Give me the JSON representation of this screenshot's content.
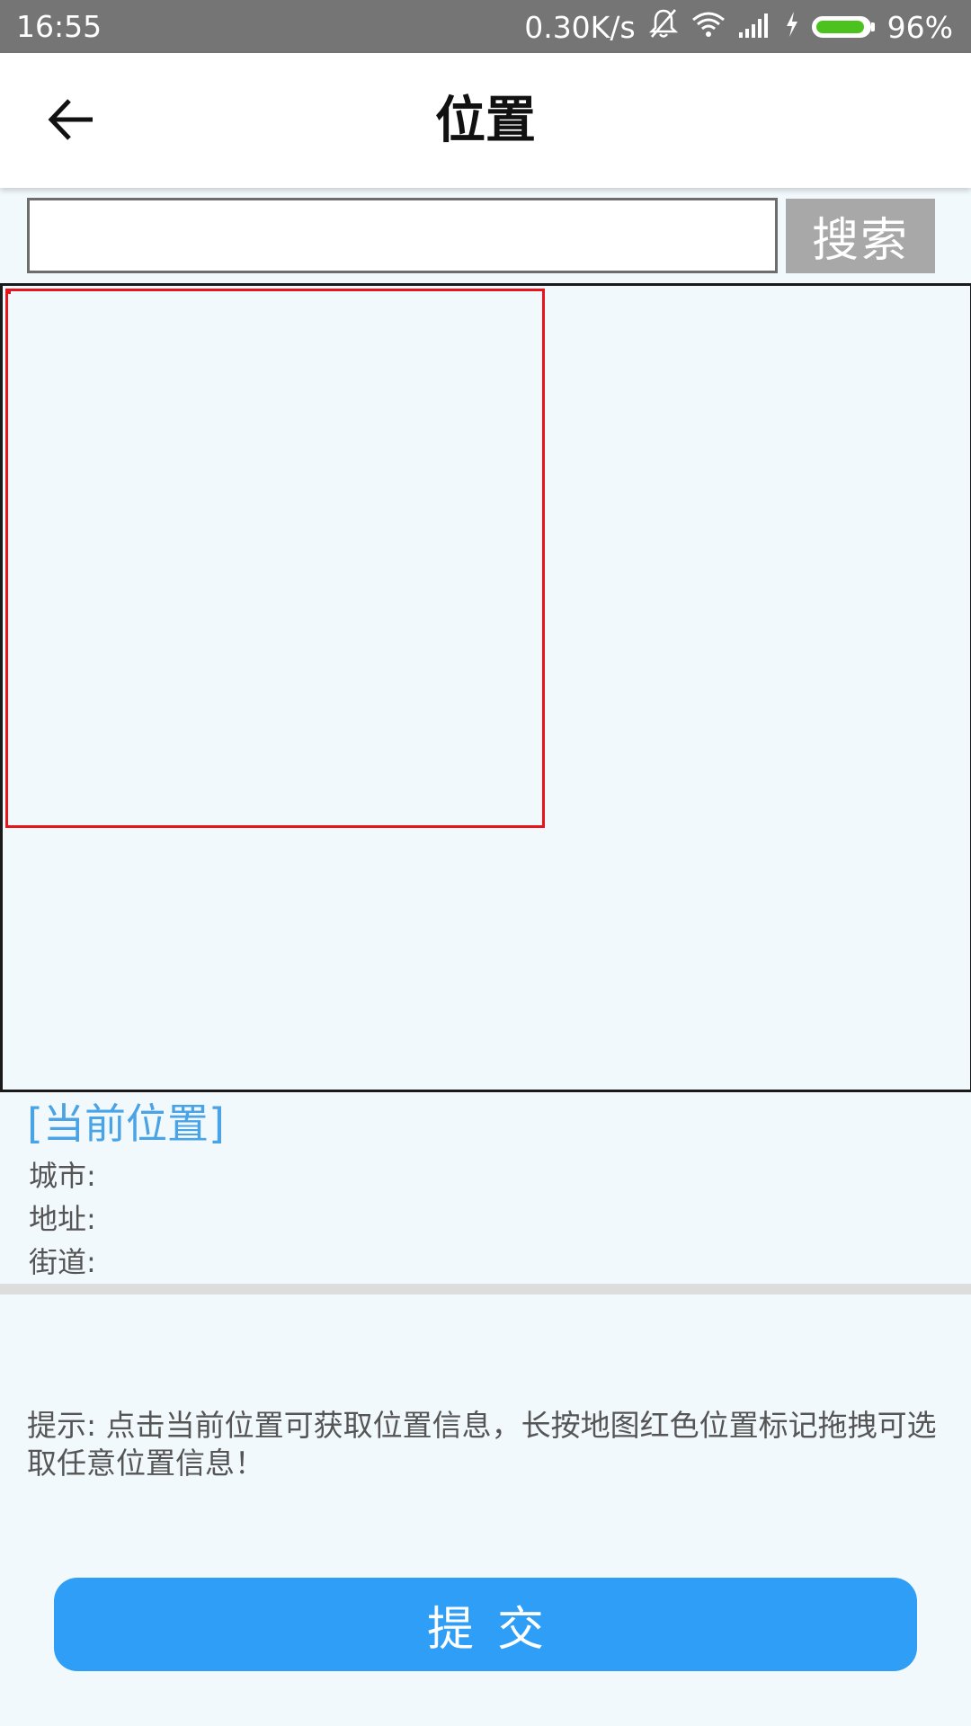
{
  "status_bar": {
    "time": "16:55",
    "network_speed": "0.30K/s",
    "battery_percent": "96%",
    "battery_level": 0.96,
    "battery_color": "#4cc21e",
    "icons": [
      "bell-off-icon",
      "wifi-icon",
      "signal-icon",
      "charging-icon",
      "battery-icon"
    ]
  },
  "app_bar": {
    "title": "位置",
    "back_icon": "arrow-left-icon"
  },
  "search": {
    "input_value": "",
    "placeholder": "",
    "button_label": "搜索"
  },
  "map": {
    "marker_color": "#e8141c"
  },
  "current_location": {
    "title": "[当前位置]",
    "city_label": "城市:",
    "city_value": "",
    "address_label": "地址:",
    "address_value": "",
    "street_label": "街道:",
    "street_value": ""
  },
  "hint": {
    "text": "提示: 点击当前位置可获取位置信息，长按地图红色位置标记拖拽可选取任意位置信息！"
  },
  "submit": {
    "label": "提交"
  },
  "colors": {
    "accent": "#2f9ef6",
    "link": "#4aa3e5",
    "background": "#f2f9fd"
  }
}
